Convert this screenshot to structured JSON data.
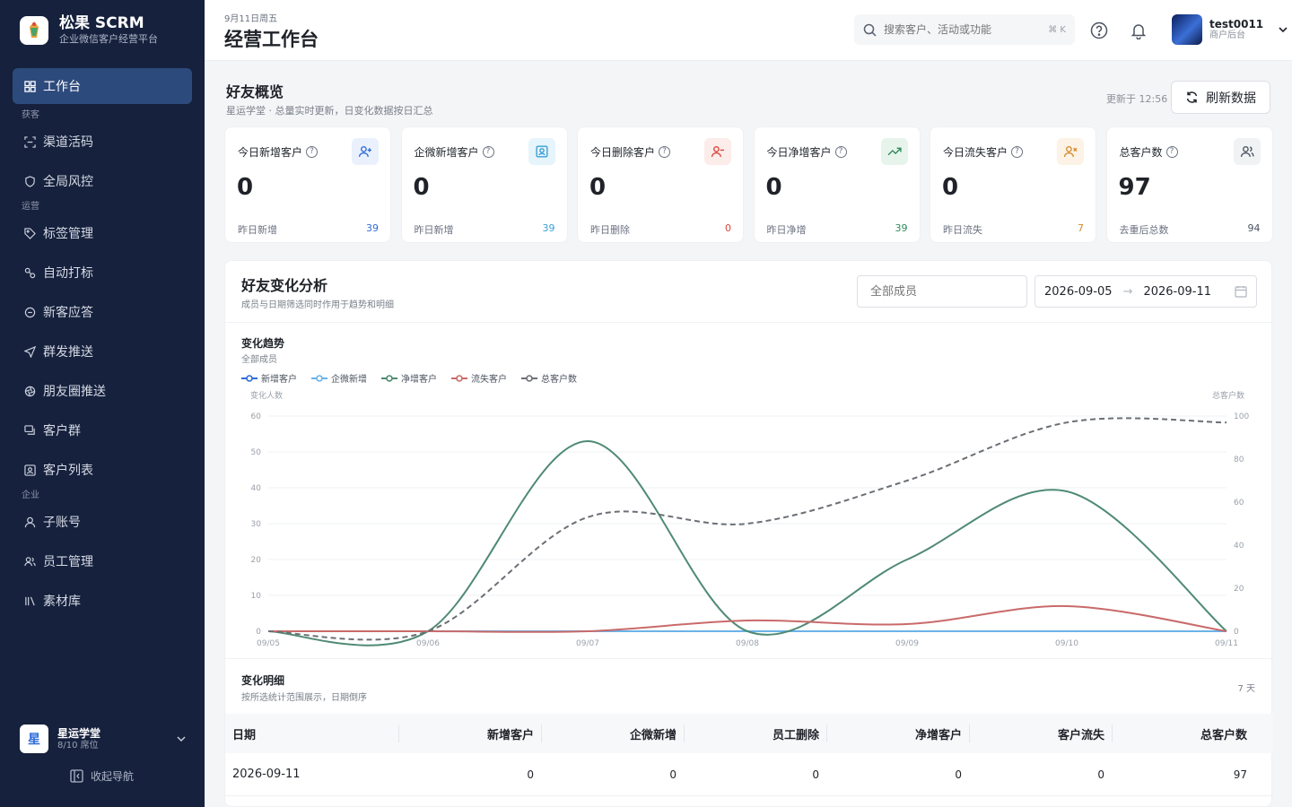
{
  "sidebar": {
    "brand_name": "松果 SCRM",
    "brand_sub": "企业微信客户经营平台",
    "active_label": "工作台",
    "groups": {
      "acquire": "获客",
      "operate": "运营",
      "enterprise": "企业"
    },
    "items": {
      "channel_code": "渠道活码",
      "risk": "全局风控",
      "tags": "标签管理",
      "auto_tag": "自动打标",
      "welcome": "新客应答",
      "mass_push": "群发推送",
      "moments": "朋友圈推送",
      "groups": "客户群",
      "customers": "客户列表",
      "sub_accounts": "子账号",
      "staff": "员工管理",
      "library": "素材库"
    },
    "org_name": "星运学堂",
    "org_seat": "8/10 席位",
    "org_avatar": "星",
    "collapse_label": "收起导航"
  },
  "header": {
    "date": "9月11日周五",
    "title": "经营工作台",
    "search_placeholder": "搜索客户、活动或功能",
    "shortcut": "⌘ K",
    "user_name": "test0011",
    "user_role": "商户后台"
  },
  "overview": {
    "title": "好友概览",
    "subtitle": "星运学堂 · 总量实时更新，日变化数据按日汇总",
    "updated": "更新于 12:56",
    "refresh_label": "刷新数据",
    "cards": [
      {
        "label": "今日新增客户",
        "value": "0",
        "foot_label": "昨日新增",
        "foot_value": "39",
        "color": "#2f6bd8",
        "icon": "user-add-icon"
      },
      {
        "label": "企微新增客户",
        "value": "0",
        "foot_label": "昨日新增",
        "foot_value": "39",
        "color": "#3a9fd8",
        "icon": "contact-card-icon"
      },
      {
        "label": "今日删除客户",
        "value": "0",
        "foot_label": "昨日删除",
        "foot_value": "0",
        "color": "#d8453a",
        "icon": "user-remove-icon"
      },
      {
        "label": "今日净增客户",
        "value": "0",
        "foot_label": "昨日净增",
        "foot_value": "39",
        "color": "#2e8a5c",
        "icon": "trend-up-icon"
      },
      {
        "label": "今日流失客户",
        "value": "0",
        "foot_label": "昨日流失",
        "foot_value": "7",
        "color": "#d4892a",
        "icon": "user-x-icon"
      },
      {
        "label": "总客户数",
        "value": "97",
        "foot_label": "去重后总数",
        "foot_value": "94",
        "color": "#4b5360",
        "icon": "users-icon"
      }
    ]
  },
  "analysis": {
    "title": "好友变化分析",
    "subtitle": "成员与日期筛选同时作用于趋势和明细",
    "member_placeholder": "全部成员",
    "date_start": "2026-09-05",
    "date_end": "2026-09-11",
    "trend_title": "变化趋势",
    "trend_sub": "全部成员",
    "detail_title": "变化明细",
    "detail_sub": "按所选统计范围展示，日期倒序",
    "detail_count": "7 天",
    "table_headers": [
      "日期",
      "新增客户",
      "企微新增",
      "员工删除",
      "净增客户",
      "客户流失",
      "总客户数"
    ],
    "table_rows": [
      [
        "2026-09-11",
        "0",
        "0",
        "0",
        "0",
        "0",
        "97"
      ]
    ]
  },
  "chart_data": {
    "type": "line",
    "x": [
      "09/05",
      "09/06",
      "09/07",
      "09/08",
      "09/09",
      "09/10",
      "09/11"
    ],
    "ylabel": "变化人数",
    "y2label": "总客户数",
    "ylim": [
      0,
      60
    ],
    "y2lim": [
      0,
      100
    ],
    "yticks": [
      0,
      10,
      20,
      30,
      40,
      50,
      60
    ],
    "y2ticks": [
      0,
      20,
      40,
      60,
      80,
      100
    ],
    "legend_position": "top-left",
    "series": [
      {
        "name": "新增客户",
        "axis": "left",
        "values": [
          0,
          0,
          0,
          0,
          0,
          0,
          0
        ],
        "color": "#2f6bd8",
        "dashed": false
      },
      {
        "name": "企微新增",
        "axis": "left",
        "values": [
          0,
          0,
          0,
          0,
          0,
          0,
          0
        ],
        "color": "#6ab3e8",
        "dashed": false
      },
      {
        "name": "净增客户",
        "axis": "left",
        "values": [
          0,
          0,
          53,
          0,
          20,
          39,
          0
        ],
        "color": "#4f8a73",
        "dashed": false
      },
      {
        "name": "流失客户",
        "axis": "left",
        "values": [
          0,
          0,
          0,
          3,
          2,
          7,
          0
        ],
        "color": "#c96a6a",
        "dashed": false
      },
      {
        "name": "总客户数",
        "axis": "right",
        "values": [
          0,
          0,
          53,
          50,
          70,
          97,
          97
        ],
        "color": "#6b6f75",
        "dashed": true
      }
    ]
  }
}
